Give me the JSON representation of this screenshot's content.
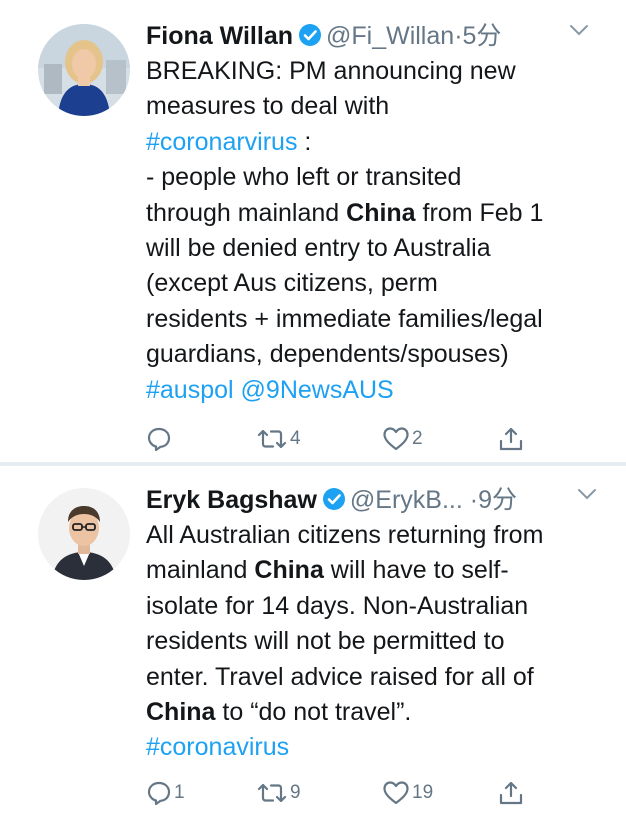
{
  "tweets": [
    {
      "name": "Fiona Willan",
      "handle": "@Fi_Willan",
      "separator": "·",
      "time": "5分",
      "lines": [
        [
          {
            "text": "BREAKING: PM announcing new",
            "style": "plain"
          }
        ],
        [
          {
            "text": "measures to deal with",
            "style": "plain"
          }
        ],
        [
          {
            "text": "#coronarvirus",
            "style": "hashtag"
          },
          {
            "text": " :",
            "style": "plain"
          }
        ],
        [
          {
            "text": "- people who left or transited",
            "style": "plain"
          }
        ],
        [
          {
            "text": "through mainland ",
            "style": "plain"
          },
          {
            "text": "China",
            "style": "bold"
          },
          {
            "text": " from Feb 1",
            "style": "plain"
          }
        ],
        [
          {
            "text": "will be denied  entry to Australia",
            "style": "plain"
          }
        ],
        [
          {
            "text": "(except Aus citizens, perm",
            "style": "plain"
          }
        ],
        [
          {
            "text": "residents + immediate families/legal",
            "style": "plain"
          }
        ],
        [
          {
            "text": "guardians, dependents/spouses)",
            "style": "plain"
          }
        ],
        [
          {
            "text": "#auspol",
            "style": "hashtag"
          },
          {
            "text": " ",
            "style": "plain"
          },
          {
            "text": "@9NewsAUS",
            "style": "mention"
          }
        ]
      ],
      "actions": {
        "reply": "",
        "retweet": "4",
        "like": "2"
      }
    },
    {
      "name": "Eryk Bagshaw",
      "handle": "@ErykB...",
      "separator": "·",
      "time": "9分",
      "lines": [
        [
          {
            "text": "All Australian citizens returning from",
            "style": "plain"
          }
        ],
        [
          {
            "text": "mainland ",
            "style": "plain"
          },
          {
            "text": "China",
            "style": "bold"
          },
          {
            "text": " will have to self-",
            "style": "plain"
          }
        ],
        [
          {
            "text": "isolate for 14 days. Non-Australian",
            "style": "plain"
          }
        ],
        [
          {
            "text": "residents will not be permitted to",
            "style": "plain"
          }
        ],
        [
          {
            "text": "enter. Travel advice raised for all of",
            "style": "plain"
          }
        ],
        [
          {
            "text": "China",
            "style": "bold"
          },
          {
            "text": " to “do not travel”.",
            "style": "plain"
          }
        ],
        [
          {
            "text": "#coronavirus",
            "style": "hashtag"
          }
        ]
      ],
      "actions": {
        "reply": "1",
        "retweet": "9",
        "like": "19"
      }
    }
  ],
  "icons": {
    "verified": "verified-badge-icon",
    "caret": "chevron-down-icon",
    "reply": "reply-icon",
    "retweet": "retweet-icon",
    "like": "heart-icon",
    "share": "share-icon"
  },
  "colors": {
    "link": "#1da1f2",
    "secondary": "#657786",
    "text": "#14171a",
    "divider": "#e6ecf0"
  }
}
